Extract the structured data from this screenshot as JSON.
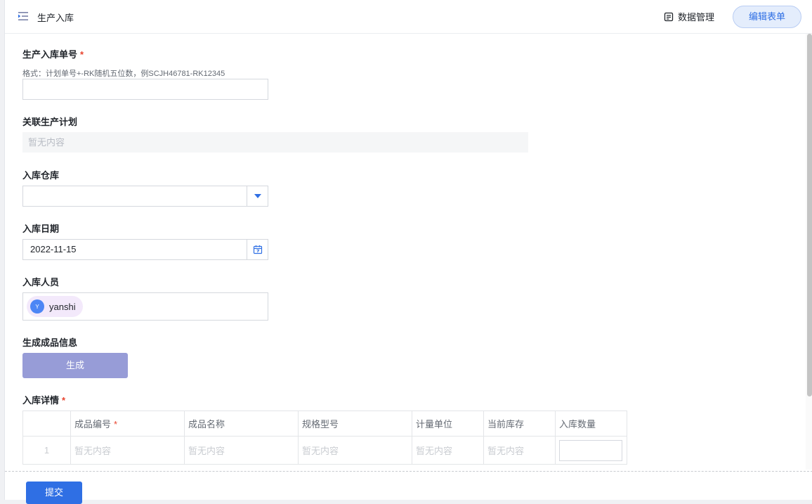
{
  "header": {
    "title": "生产入库",
    "data_management": "数据管理",
    "edit_form": "编辑表单"
  },
  "form": {
    "order_no": {
      "label": "生产入库单号",
      "required_mark": "*",
      "hint": "格式：计划单号+-RK随机五位数，例SCJH46781-RK12345",
      "value": ""
    },
    "related_plan": {
      "label": "关联生产计划",
      "placeholder": "暂无内容"
    },
    "warehouse": {
      "label": "入库仓库",
      "value": ""
    },
    "date": {
      "label": "入库日期",
      "value": "2022-11-15"
    },
    "staff": {
      "label": "入库人员",
      "members": [
        {
          "initial": "Y",
          "name": "yanshi"
        }
      ]
    },
    "generate": {
      "label": "生成成品信息",
      "button": "生成"
    },
    "details": {
      "label": "入库详情",
      "required_mark": "*",
      "columns": [
        "",
        "成品编号",
        "成品名称",
        "规格型号",
        "计量单位",
        "当前库存",
        "入库数量"
      ],
      "column_required": "*",
      "rows": [
        {
          "index": "1",
          "cells": [
            "暂无内容",
            "暂无内容",
            "暂无内容",
            "暂无内容",
            "暂无内容"
          ]
        }
      ]
    }
  },
  "footer": {
    "submit": "提交"
  },
  "colors": {
    "primary": "#2f6fe4",
    "generate_button": "#979cd7",
    "required": "#e8432e"
  }
}
